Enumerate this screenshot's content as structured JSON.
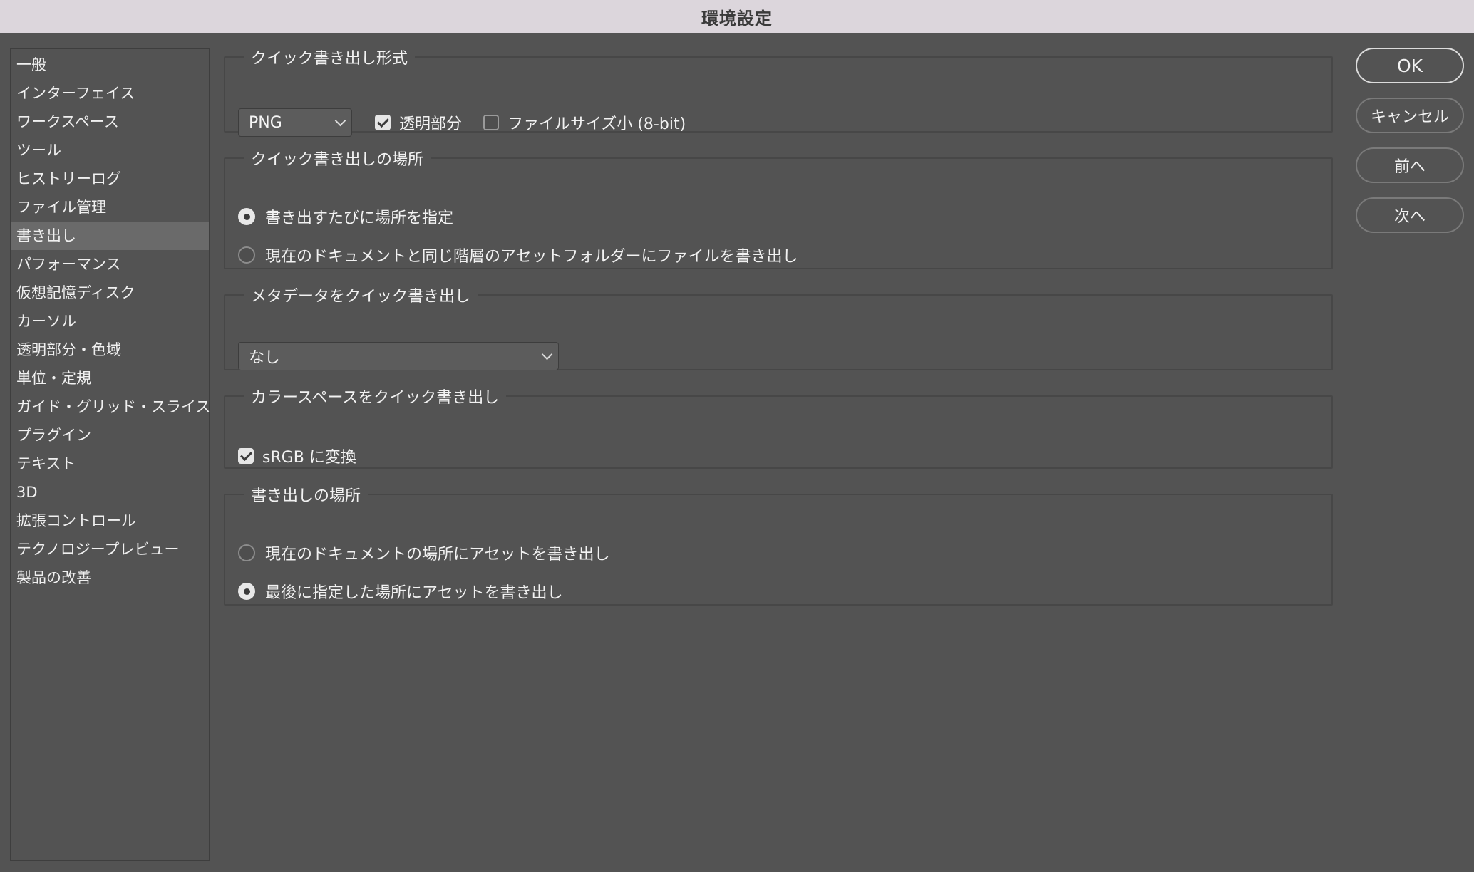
{
  "window": {
    "title": "環境設定"
  },
  "sidebar": {
    "items": [
      {
        "label": "一般"
      },
      {
        "label": "インターフェイス"
      },
      {
        "label": "ワークスペース"
      },
      {
        "label": "ツール"
      },
      {
        "label": "ヒストリーログ"
      },
      {
        "label": "ファイル管理"
      },
      {
        "label": "書き出し",
        "selected": true
      },
      {
        "label": "パフォーマンス"
      },
      {
        "label": "仮想記憶ディスク"
      },
      {
        "label": "カーソル"
      },
      {
        "label": "透明部分・色域"
      },
      {
        "label": "単位・定規"
      },
      {
        "label": "ガイド・グリッド・スライス"
      },
      {
        "label": "プラグイン"
      },
      {
        "label": "テキスト"
      },
      {
        "label": "3D"
      },
      {
        "label": "拡張コントロール"
      },
      {
        "label": "テクノロジープレビュー"
      },
      {
        "label": "製品の改善"
      }
    ]
  },
  "quick_export_format": {
    "legend": "クイック書き出し形式",
    "format_value": "PNG",
    "transparency_label": "透明部分",
    "transparency_checked": true,
    "small_file_label": "ファイルサイズ小 (8-bit)",
    "small_file_checked": false
  },
  "quick_export_location": {
    "legend": "クイック書き出しの場所",
    "option_ask": "書き出すたびに場所を指定",
    "option_ask_selected": true,
    "option_assets_folder": "現在のドキュメントと同じ階層のアセットフォルダーにファイルを書き出し",
    "option_assets_folder_selected": false
  },
  "quick_export_metadata": {
    "legend": "メタデータをクイック書き出し",
    "value": "なし"
  },
  "quick_export_colorspace": {
    "legend": "カラースペースをクイック書き出し",
    "srgb_label": "sRGB に変換",
    "srgb_checked": true
  },
  "export_location": {
    "legend": "書き出しの場所",
    "option_current_doc": "現在のドキュメントの場所にアセットを書き出し",
    "option_current_doc_selected": false,
    "option_last_used": "最後に指定した場所にアセットを書き出し",
    "option_last_used_selected": true
  },
  "buttons": {
    "ok": "OK",
    "cancel": "キャンセル",
    "prev": "前へ",
    "next": "次へ"
  }
}
